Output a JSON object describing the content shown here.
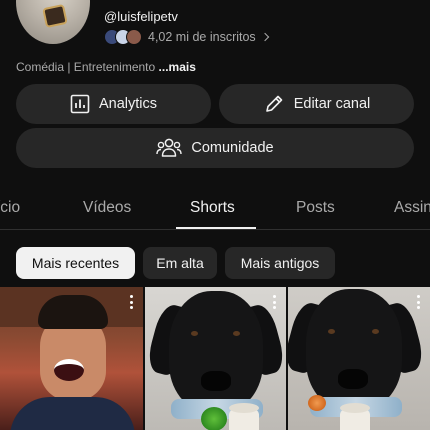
{
  "channel": {
    "handle": "@luisfelipetv",
    "subscribers": "4,02 mi de inscritos",
    "categories": "Comédia | Entretenimento",
    "more_label": "...mais",
    "mini_avatar_colors": [
      "#3a4a7a",
      "#c9d4e8",
      "#8a5a4a"
    ]
  },
  "actions": {
    "analytics_label": "Analytics",
    "edit_label": "Editar canal",
    "community_label": "Comunidade"
  },
  "tabs": [
    {
      "label": "ício"
    },
    {
      "label": "Vídeos"
    },
    {
      "label": "Shorts"
    },
    {
      "label": "Posts"
    },
    {
      "label": "Assin"
    }
  ],
  "active_tab": "Shorts",
  "filters": [
    {
      "label": "Mais recentes",
      "selected": true
    },
    {
      "label": "Em alta",
      "selected": false
    },
    {
      "label": "Mais antigos",
      "selected": false
    }
  ],
  "colors": {
    "background": "#0f0f0f",
    "surface": "#272727",
    "text_primary": "#f1f1f1",
    "text_secondary": "#aaaaaa"
  },
  "icons": [
    "analytics-icon",
    "pencil-icon",
    "community-icon",
    "chevron-right-icon",
    "more-vert-icon"
  ]
}
